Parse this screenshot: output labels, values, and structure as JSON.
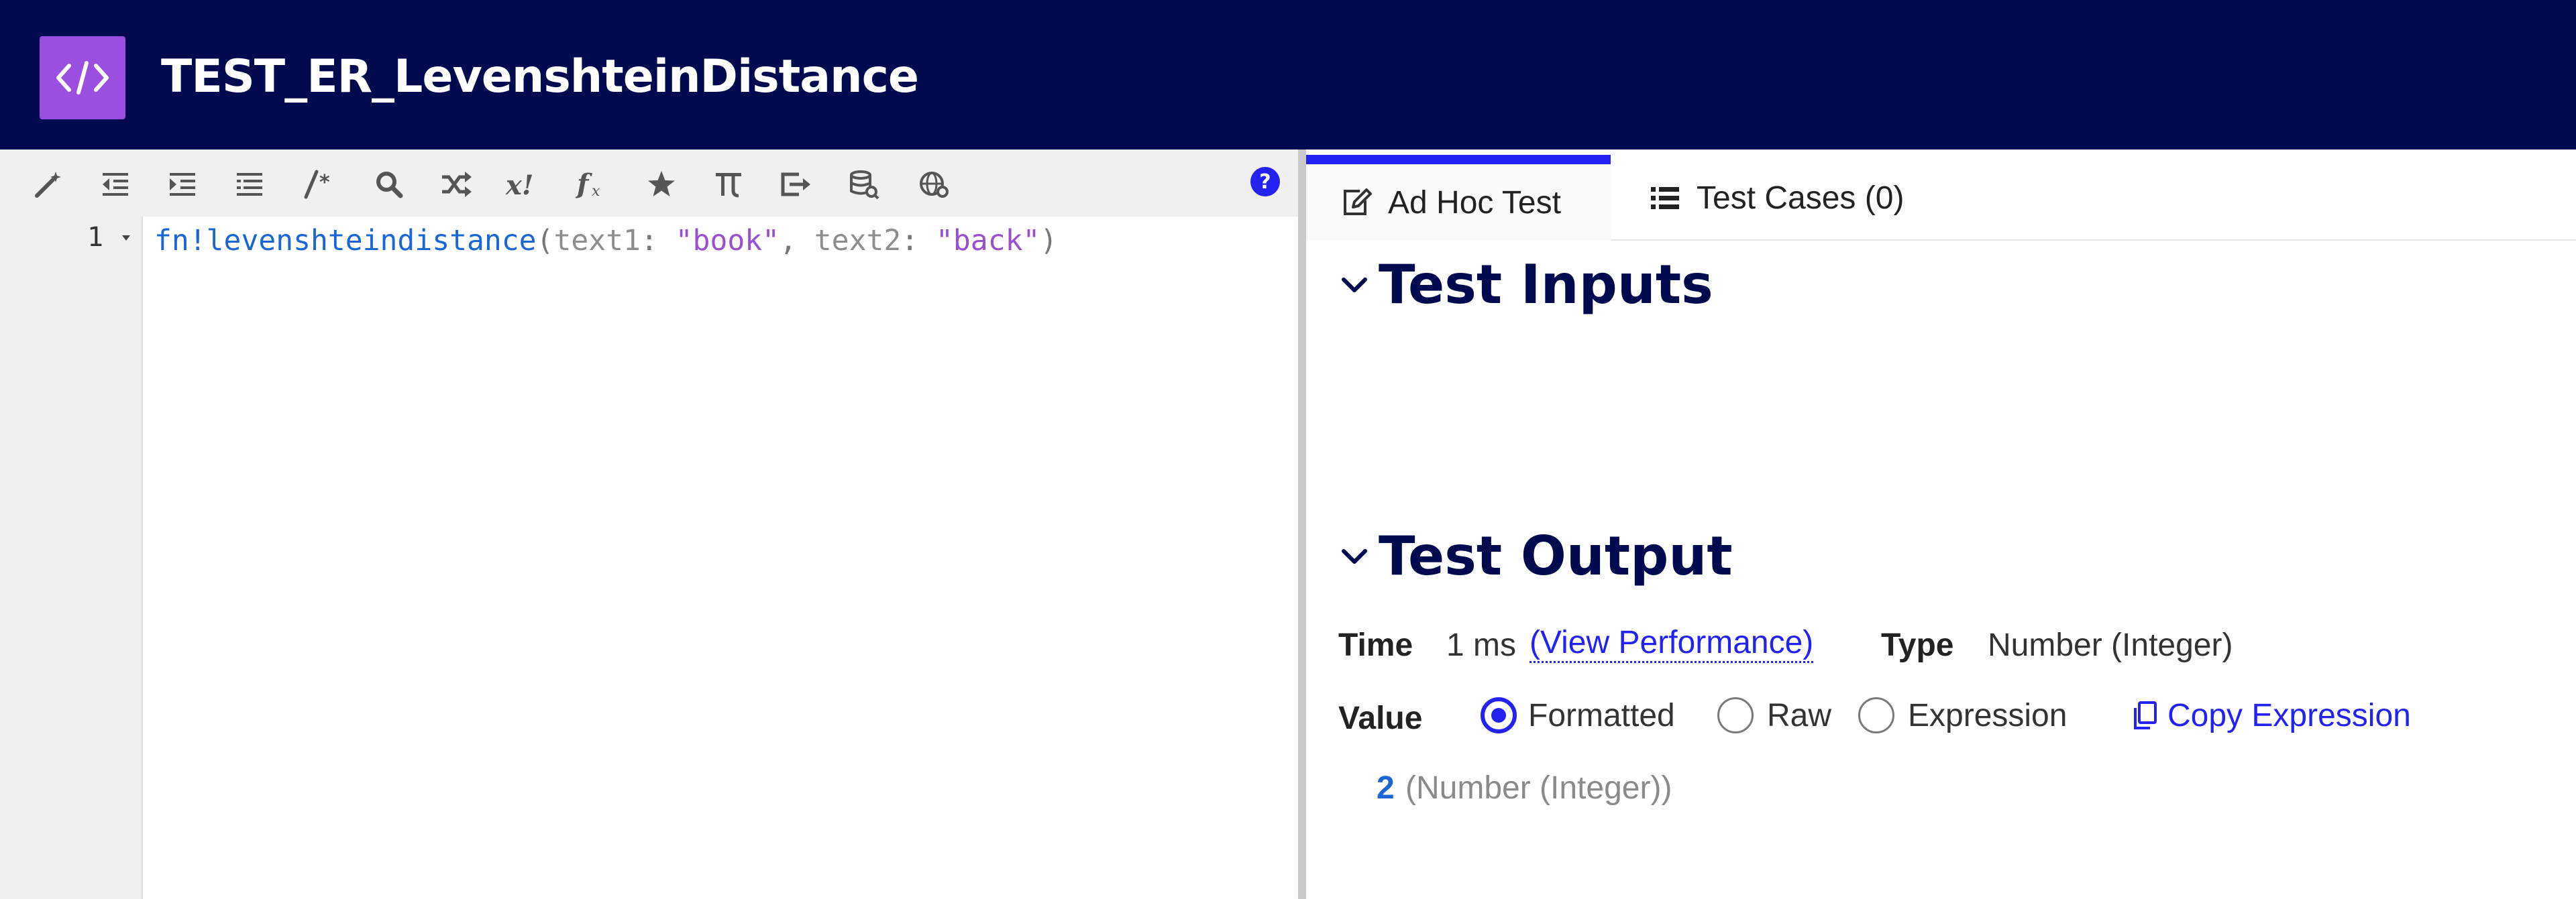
{
  "header": {
    "title": "TEST_ER_LevenshteinDistance",
    "logo_icon": "code-brackets-icon",
    "background": "#010a4f",
    "logo_color": "#9a4fe0"
  },
  "toolbar": {
    "icons": [
      "magic-wand-icon",
      "outdent-icon",
      "indent-icon",
      "list-icon",
      "comment-icon",
      "search-icon",
      "shuffle-icon",
      "local-variable-icon",
      "function-icon",
      "star-icon",
      "pi-icon",
      "export-icon",
      "database-icon",
      "globe-icon"
    ],
    "help_icon": "help-icon"
  },
  "editor": {
    "line_number": "1",
    "code": {
      "fn": "fn!levenshteindistance",
      "open_paren": "(",
      "param1": "text1",
      "colon1": ": ",
      "value1": "\"book\"",
      "comma": ", ",
      "param2": "text2",
      "colon2": ": ",
      "value2": "\"back\"",
      "close_paren": ")"
    }
  },
  "tabs": [
    {
      "label": "Ad Hoc Test",
      "icon": "edit-icon",
      "active": true
    },
    {
      "label": "Test Cases (0)",
      "icon": "list-icon",
      "active": false
    }
  ],
  "test_inputs": {
    "heading": "Test Inputs"
  },
  "test_output": {
    "heading": "Test Output",
    "time_label": "Time",
    "time_value": "1 ms",
    "view_performance": "(View Performance)",
    "type_label": "Type",
    "type_value": "Number (Integer)",
    "value_label": "Value",
    "options": [
      "Formatted",
      "Raw",
      "Expression"
    ],
    "selected_option": "Formatted",
    "copy_expression": "Copy Expression",
    "result_value": "2",
    "result_type": "(Number (Integer))"
  },
  "colors": {
    "accent": "#2322f0",
    "function": "#1a66d6",
    "string": "#9a4fd0",
    "param": "#8d8d8d"
  }
}
